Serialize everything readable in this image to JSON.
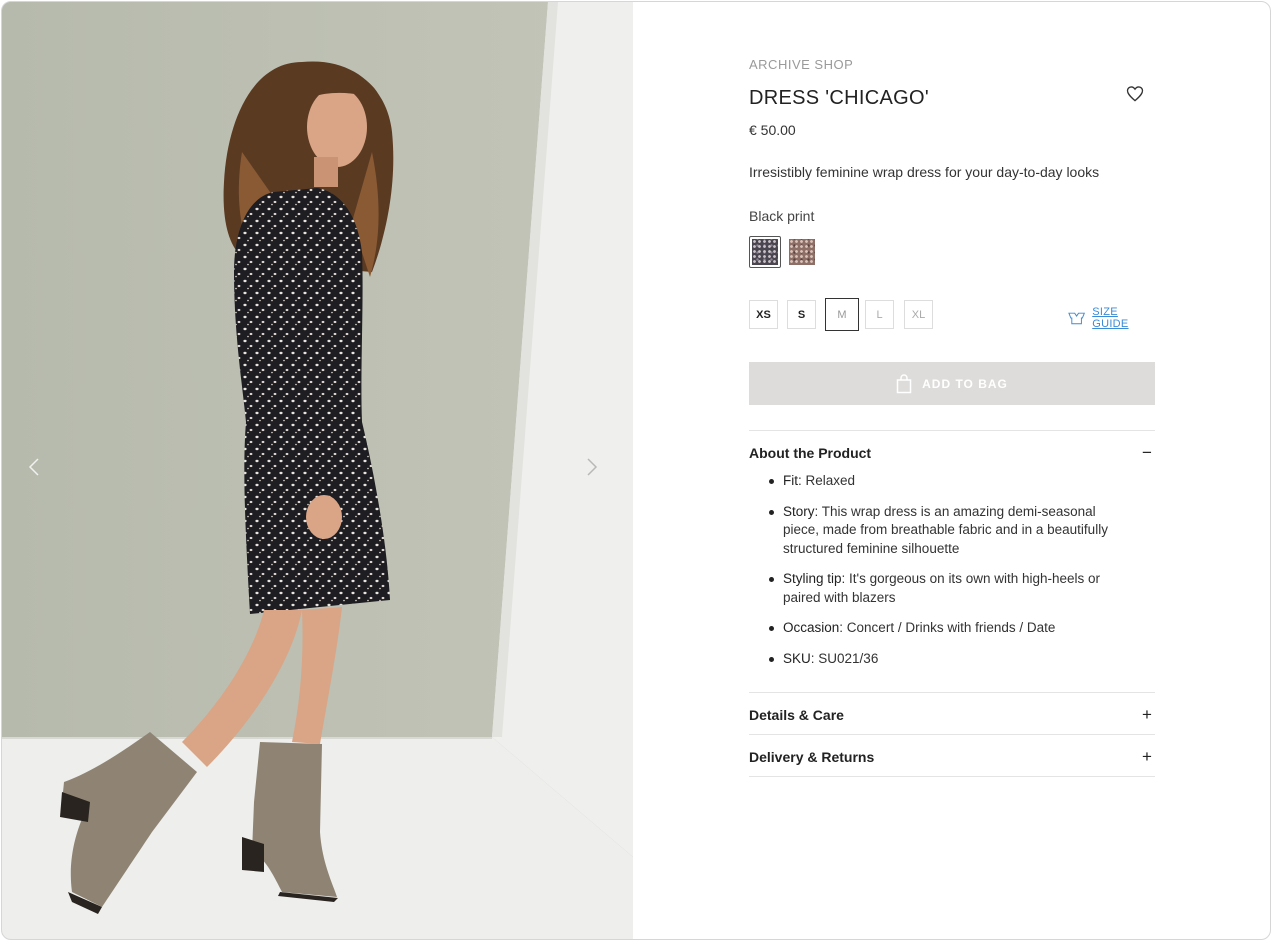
{
  "product": {
    "brand": "ARCHIVE SHOP",
    "title": "DRESS 'CHICAGO'",
    "price": "€ 50.00",
    "description": "Irresistibly feminine wrap dress for your day-to-day looks",
    "color_label": "Black print",
    "wishlist_icon": "heart-icon"
  },
  "gallery": {
    "prev_icon": "chevron-left-icon",
    "next_icon": "chevron-right-icon"
  },
  "swatches": [
    {
      "name": "Black print",
      "selected": true,
      "color": "#4a4650"
    },
    {
      "name": "Brown print",
      "selected": false,
      "color": "#8e6f68"
    }
  ],
  "sizes": [
    {
      "label": "XS",
      "state": "available"
    },
    {
      "label": "S",
      "state": "available"
    },
    {
      "label": "M",
      "state": "selected"
    },
    {
      "label": "L",
      "state": "unavailable"
    },
    {
      "label": "XL",
      "state": "unavailable"
    }
  ],
  "size_guide": {
    "label": "SIZE GUIDE",
    "icon": "hanger-icon"
  },
  "add_to_bag": {
    "label": "ADD TO BAG",
    "icon": "shopping-bag-icon",
    "enabled": false
  },
  "accordion": {
    "about": {
      "title": "About the Product",
      "toggle": "−",
      "items": [
        {
          "key": "Fit",
          "value": "Relaxed"
        },
        {
          "key": "Story",
          "value": "This wrap dress is an amazing demi-seasonal piece, made from breathable fabric and in a beautifully structured feminine silhouette"
        },
        {
          "key": "Styling tip",
          "value": "It's gorgeous on its own with high-heels or paired with blazers"
        },
        {
          "key": "Occasion",
          "value": "Concert / Drinks with friends / Date"
        },
        {
          "key": "SKU",
          "value": "SU021/36"
        }
      ]
    },
    "details": {
      "title": "Details & Care",
      "toggle": "+"
    },
    "delivery": {
      "title": "Delivery & Returns",
      "toggle": "+"
    }
  },
  "colors": {
    "accent_link": "#3b8bd6",
    "button_disabled": "#dedcda"
  }
}
